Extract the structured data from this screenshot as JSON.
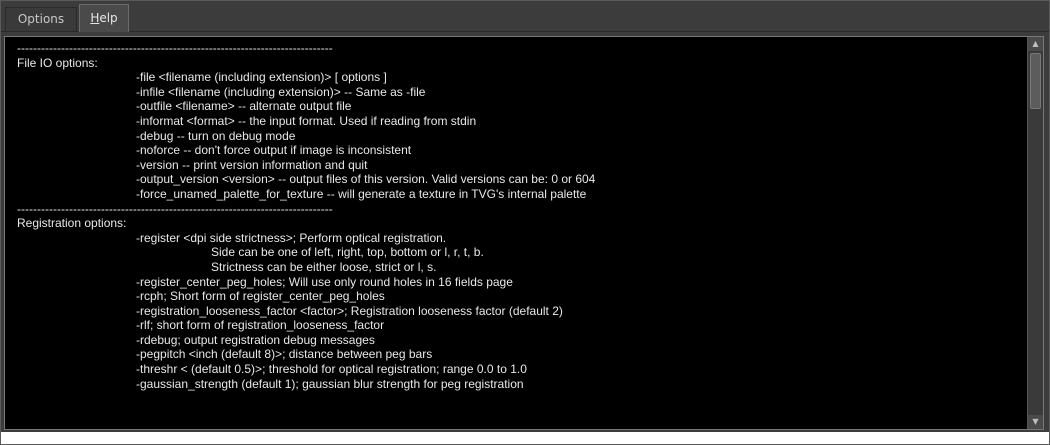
{
  "tabs": {
    "options": "Options",
    "help_first": "H",
    "help_rest": "elp"
  },
  "help_text": [
    {
      "indent": 0,
      "text": "-------------------------------------------------------------------------------"
    },
    {
      "indent": 0,
      "text": "File IO options:"
    },
    {
      "indent": 1,
      "text": "-file <filename (including extension)> [ options ]"
    },
    {
      "indent": 1,
      "text": "-infile <filename (including extension)> -- Same as -file"
    },
    {
      "indent": 1,
      "text": "-outfile <filename> -- alternate output file"
    },
    {
      "indent": 1,
      "text": "-informat <format> -- the input format. Used if reading from stdin"
    },
    {
      "indent": 1,
      "text": "-debug -- turn on debug mode"
    },
    {
      "indent": 1,
      "text": "-noforce -- don't force output if image is inconsistent"
    },
    {
      "indent": 1,
      "text": "-version -- print version information and quit"
    },
    {
      "indent": 1,
      "text": "-output_version <version> -- output files of this version. Valid versions can be: 0 or 604"
    },
    {
      "indent": 1,
      "text": "-force_unamed_palette_for_texture -- will generate a texture in TVG's internal palette"
    },
    {
      "indent": 0,
      "text": "-------------------------------------------------------------------------------"
    },
    {
      "indent": 0,
      "text": "Registration options:"
    },
    {
      "indent": 1,
      "text": "-register <dpi side strictness>; Perform optical registration."
    },
    {
      "indent": 2,
      "text": "Side can be one of left, right, top, bottom or l, r, t, b."
    },
    {
      "indent": 2,
      "text": "Strictness can be either loose, strict or l, s."
    },
    {
      "indent": 1,
      "text": "-register_center_peg_holes; Will use only round holes in 16 fields page"
    },
    {
      "indent": 1,
      "text": "-rcph; Short form of register_center_peg_holes"
    },
    {
      "indent": 1,
      "text": "-registration_looseness_factor <factor>; Registration looseness factor (default 2)"
    },
    {
      "indent": 1,
      "text": "-rlf; short form of registration_looseness_factor"
    },
    {
      "indent": 1,
      "text": "-rdebug; output registration debug messages"
    },
    {
      "indent": 1,
      "text": "-pegpitch <inch (default 8)>; distance between peg bars"
    },
    {
      "indent": 1,
      "text": "-threshr < (default 0.5)>; threshold for optical registration; range 0.0 to 1.0"
    },
    {
      "indent": 1,
      "text": "-gaussian_strength (default 1); gaussian blur strength for peg registration"
    }
  ]
}
